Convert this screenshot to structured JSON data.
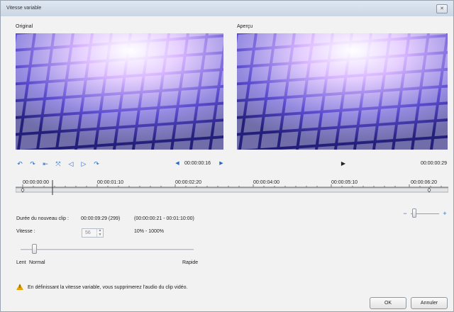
{
  "window": {
    "title": "Vitesse variable",
    "close_label": "✕"
  },
  "panels": {
    "original_label": "Original",
    "preview_label": "Aperçu"
  },
  "original_controls": {
    "buttons": [
      "↶",
      "↷",
      "⇤",
      "⤧",
      "◁",
      "▷",
      "↷"
    ],
    "timecode": "00:00:00:16"
  },
  "preview_controls": {
    "play_symbol": "▶",
    "timecode": "00:00:00:29"
  },
  "timeline": {
    "labels": [
      "00:00:00:00",
      "00:00:01:10",
      "00:00:02:20",
      "00:00:04:00",
      "00:00:05:10",
      "00:00:06:20"
    ]
  },
  "info": {
    "duration_label": "Durée du nouveau clip :",
    "duration_value": "00:00:09:29 (299)",
    "duration_range": "(00:00:00:21 - 00:01:10:00)",
    "speed_label": "Vitesse :",
    "speed_value": "56",
    "speed_range": "10% - 1000%"
  },
  "speed_slider": {
    "min_label": "Lent",
    "normal_label": "Normal",
    "max_label": "Rapide",
    "level_percent": 56
  },
  "zoom": {
    "minus": "−",
    "plus": "+"
  },
  "warning": {
    "text": "En définissant la vitesse variable, vous supprimerez l'audio du clip vidéo."
  },
  "footer": {
    "ok_label": "OK",
    "cancel_label": "Annuler"
  },
  "colors": {
    "accent": "#2a66c4",
    "warning": "#e3a400"
  }
}
